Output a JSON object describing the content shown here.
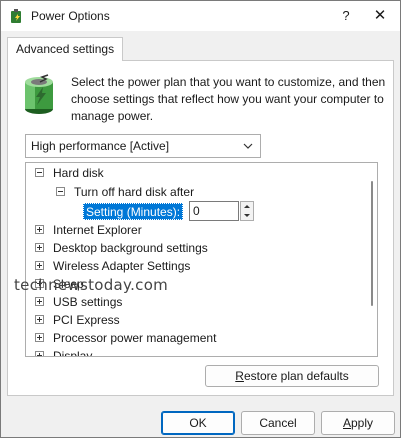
{
  "window": {
    "title": "Power Options",
    "help_glyph": "?",
    "close_glyph": "✕",
    "accent_color": "#0078d7"
  },
  "tabs": [
    {
      "label": "Advanced settings",
      "active": true
    }
  ],
  "intro": {
    "text": "Select the power plan that you want to customize, and then choose settings that reflect how you want your computer to manage power."
  },
  "plan_select": {
    "value": "High performance [Active]"
  },
  "tree": {
    "items": [
      {
        "label": "Hard disk",
        "state": "expanded"
      },
      {
        "label": "Turn off hard disk after",
        "state": "expanded"
      },
      {
        "label": "Setting (Minutes):",
        "value": "0"
      },
      {
        "label": "Internet Explorer",
        "state": "collapsed"
      },
      {
        "label": "Desktop background settings",
        "state": "collapsed"
      },
      {
        "label": "Wireless Adapter Settings",
        "state": "collapsed"
      },
      {
        "label": "Sleep",
        "state": "collapsed"
      },
      {
        "label": "USB settings",
        "state": "collapsed"
      },
      {
        "label": "PCI Express",
        "state": "collapsed"
      },
      {
        "label": "Processor power management",
        "state": "collapsed"
      },
      {
        "label": "Display",
        "state": "collapsed"
      }
    ]
  },
  "watermark": "technewstoday.com",
  "buttons": {
    "restore_pre": "",
    "restore_key": "R",
    "restore_post": "estore plan defaults",
    "ok": "OK",
    "cancel": "Cancel",
    "apply_key": "A",
    "apply_post": "pply"
  }
}
